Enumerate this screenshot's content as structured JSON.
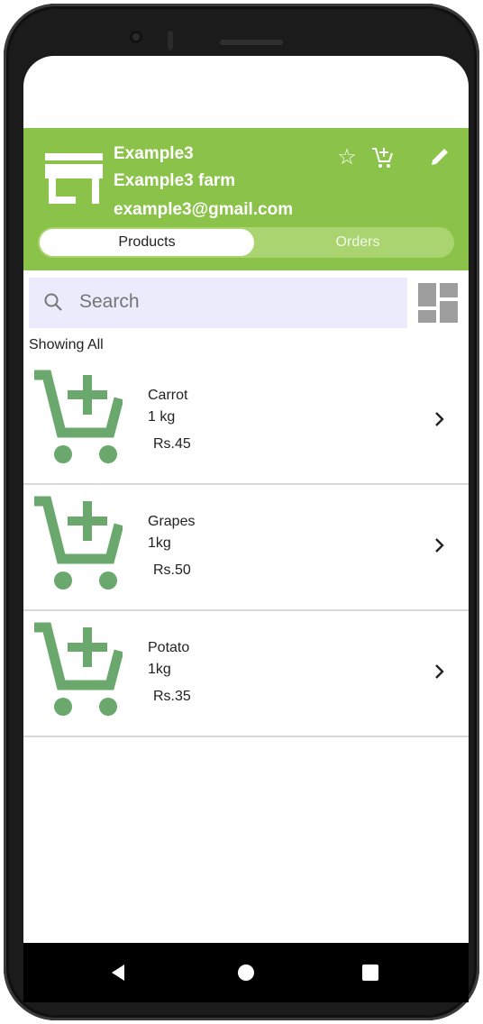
{
  "header": {
    "name": "Example3",
    "farm": "Example3 farm",
    "email": "example3@gmail.com"
  },
  "icons": {
    "store": "store-icon",
    "favorite": "star-outline-icon",
    "cart": "add-shopping-cart-icon",
    "edit": "pencil-icon",
    "search": "search-icon",
    "view_toggle": "grid-view-icon",
    "chevron": "chevron-right-icon"
  },
  "tabs": [
    {
      "label": "Products",
      "selected": true
    },
    {
      "label": "Orders",
      "selected": false
    }
  ],
  "search": {
    "placeholder": "Search"
  },
  "filter_label": "Showing All",
  "products": [
    {
      "name": "Carrot",
      "quantity": "1 kg",
      "price": "Rs.45"
    },
    {
      "name": "Grapes",
      "quantity": "1kg",
      "price": "Rs.50"
    },
    {
      "name": "Potato",
      "quantity": "1kg",
      "price": "Rs.35"
    }
  ],
  "colors": {
    "header": "#8bc34a",
    "tab_track": "#a9d46f",
    "search_bg": "#ecebfb",
    "product_icon": "#6aa86d"
  }
}
